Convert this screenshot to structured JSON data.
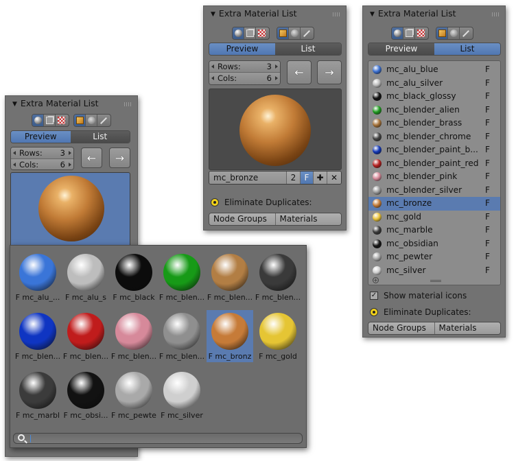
{
  "panel_title": "Extra Material List",
  "tabs": {
    "preview": "Preview",
    "list": "List"
  },
  "rows_label": "Rows:",
  "rows_value": "3",
  "cols_label": "Cols:",
  "cols_value": "6",
  "arrows": {
    "left": "←",
    "right": "→"
  },
  "active_material": "mc_bronze",
  "user_count": "2",
  "fake_user": "F",
  "eliminate_label": "Eliminate Duplicates:",
  "node_groups_label": "Node Groups",
  "materials_label": "Materials",
  "show_icons_label": "Show material icons",
  "list_items": [
    {
      "name": "mc_alu_blue",
      "flag": "F",
      "color": "#3a6fd0"
    },
    {
      "name": "mc_alu_silver",
      "flag": "F",
      "color": "#b9b9b9"
    },
    {
      "name": "mc_black_glossy",
      "flag": "F",
      "color": "#111111"
    },
    {
      "name": "mc_blender_alien",
      "flag": "F",
      "color": "#1f9a1f"
    },
    {
      "name": "mc_blender_brass",
      "flag": "F",
      "color": "#a6733a"
    },
    {
      "name": "mc_blender_chrome",
      "flag": "F",
      "color": "#444444"
    },
    {
      "name": "mc_blender_paint_b...",
      "flag": "F",
      "color": "#1136b5"
    },
    {
      "name": "mc_blender_paint_red",
      "flag": "F",
      "color": "#b52020"
    },
    {
      "name": "mc_blender_pink",
      "flag": "F",
      "color": "#d78a9a"
    },
    {
      "name": "mc_blender_silver",
      "flag": "F",
      "color": "#9a9a9a"
    },
    {
      "name": "mc_bronze",
      "flag": "F",
      "color": "#c57d3a"
    },
    {
      "name": "mc_gold",
      "flag": "F",
      "color": "#e8c23a"
    },
    {
      "name": "mc_marble",
      "flag": "F",
      "color": "#3a3a3a"
    },
    {
      "name": "mc_obsidian",
      "flag": "F",
      "color": "#151515"
    },
    {
      "name": "mc_pewter",
      "flag": "F",
      "color": "#a8a8a8"
    },
    {
      "name": "mc_silver",
      "flag": "F",
      "color": "#d0d0d0"
    }
  ],
  "grid_items": [
    {
      "caption": "F mc_alu_...",
      "color": "#3a75d8"
    },
    {
      "caption": "F mc_alu_s",
      "color": "#bdbdbd"
    },
    {
      "caption": "F mc_black",
      "color": "#0c0c0c"
    },
    {
      "caption": "F mc_blen...",
      "color": "#179a17"
    },
    {
      "caption": "F mc_blen...",
      "color": "#b27e44"
    },
    {
      "caption": "F mc_blen...",
      "color": "#3a3a3a"
    },
    {
      "caption": "F mc_blen...",
      "color": "#0f35c2"
    },
    {
      "caption": "F mc_blen...",
      "color": "#c01c1c"
    },
    {
      "caption": "F mc_blen...",
      "color": "#d6899a"
    },
    {
      "caption": "F mc_blen...",
      "color": "#8f8f8f"
    },
    {
      "caption": "F mc_bronz",
      "color": "#c67b38"
    },
    {
      "caption": "F mc_gold",
      "color": "#e5c534"
    },
    {
      "caption": "F mc_marbl",
      "color": "#3b3b3b"
    },
    {
      "caption": "F mc_obsi...",
      "color": "#121212"
    },
    {
      "caption": "F mc_pewte",
      "color": "#a9a9a9"
    },
    {
      "caption": "F mc_silver",
      "color": "#cfcfcf"
    }
  ],
  "selected_grid_index": 10,
  "selected_list_index": 10
}
